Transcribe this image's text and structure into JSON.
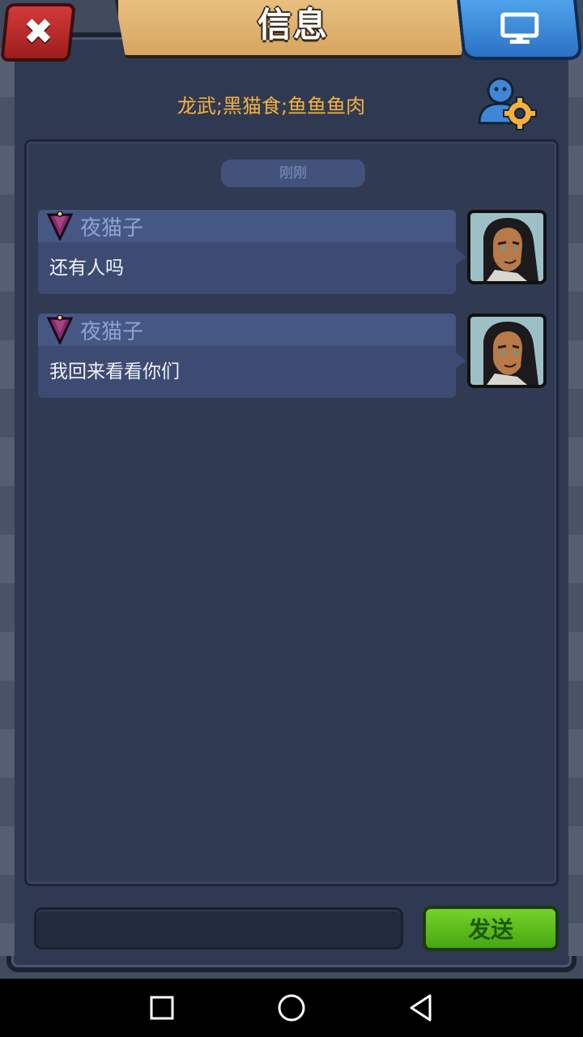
{
  "header": {
    "title": "信息",
    "close_icon": "close-icon",
    "screen_icon": "monitor-icon"
  },
  "channel": {
    "name": "龙武;黑猫食;鱼鱼鱼肉",
    "settings_icon": "user-settings-icon"
  },
  "chat": {
    "timestamp": "刚刚",
    "messages": [
      {
        "sender": "夜猫子",
        "text": "还有人吗",
        "rank_icon": "pennant-icon",
        "avatar": "hero-avatar"
      },
      {
        "sender": "夜猫子",
        "text": "我回来看看你们",
        "rank_icon": "pennant-icon",
        "avatar": "hero-avatar"
      }
    ]
  },
  "composer": {
    "input_value": "",
    "send_label": "发送"
  },
  "navbar": {
    "items": [
      "recents-icon",
      "home-icon",
      "back-icon"
    ]
  },
  "colors": {
    "accent_gold": "#f5b13f",
    "send_green": "#5cbc1c",
    "close_red": "#c02a2a",
    "screen_blue": "#3a86d8"
  }
}
